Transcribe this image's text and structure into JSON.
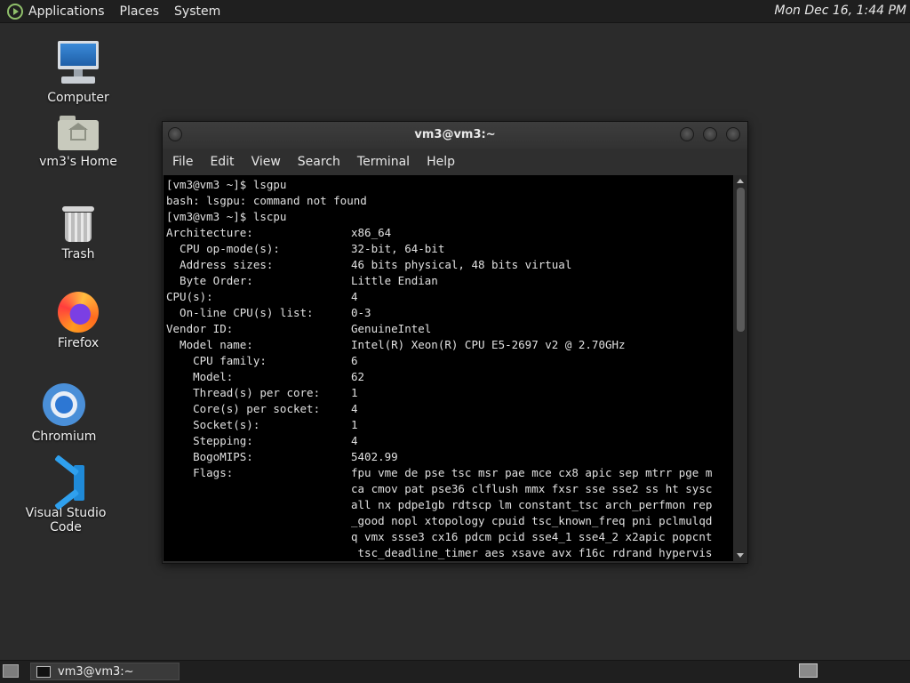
{
  "top_panel": {
    "menus": [
      "Applications",
      "Places",
      "System"
    ],
    "clock": "Mon Dec 16, 1:44 PM"
  },
  "desktop_icons": [
    {
      "label": "Computer",
      "icon": "computer-icon"
    },
    {
      "label": "vm3's Home",
      "icon": "home-folder-icon"
    },
    {
      "label": "Trash",
      "icon": "trash-icon"
    },
    {
      "label": "Firefox",
      "icon": "firefox-icon"
    },
    {
      "label": "Chromium",
      "icon": "chromium-icon"
    },
    {
      "label": "Visual Studio Code",
      "icon": "vscode-icon"
    }
  ],
  "terminal": {
    "title": "vm3@vm3:~",
    "menu": [
      "File",
      "Edit",
      "View",
      "Search",
      "Terminal",
      "Help"
    ],
    "lines": [
      {
        "text": "[vm3@vm3 ~]$ lsgpu"
      },
      {
        "text": "bash: lsgpu: command not found"
      },
      {
        "text": "[vm3@vm3 ~]$ lscpu"
      },
      {
        "key": "Architecture:",
        "value": "x86_64"
      },
      {
        "key": "  CPU op-mode(s):",
        "value": "32-bit, 64-bit"
      },
      {
        "key": "  Address sizes:",
        "value": "46 bits physical, 48 bits virtual"
      },
      {
        "key": "  Byte Order:",
        "value": "Little Endian"
      },
      {
        "key": "CPU(s):",
        "value": "4"
      },
      {
        "key": "  On-line CPU(s) list:",
        "value": "0-3"
      },
      {
        "key": "Vendor ID:",
        "value": "GenuineIntel"
      },
      {
        "key": "  Model name:",
        "value": "Intel(R) Xeon(R) CPU E5-2697 v2 @ 2.70GHz"
      },
      {
        "key": "    CPU family:",
        "value": "6"
      },
      {
        "key": "    Model:",
        "value": "62"
      },
      {
        "key": "    Thread(s) per core:",
        "value": "1"
      },
      {
        "key": "    Core(s) per socket:",
        "value": "4"
      },
      {
        "key": "    Socket(s):",
        "value": "1"
      },
      {
        "key": "    Stepping:",
        "value": "4"
      },
      {
        "key": "    BogoMIPS:",
        "value": "5402.99"
      },
      {
        "key": "    Flags:",
        "value": "fpu vme de pse tsc msr pae mce cx8 apic sep mtrr pge m"
      },
      {
        "key": "",
        "value": "ca cmov pat pse36 clflush mmx fxsr sse sse2 ss ht sysc"
      },
      {
        "key": "",
        "value": "all nx pdpe1gb rdtscp lm constant_tsc arch_perfmon rep"
      },
      {
        "key": "",
        "value": "_good nopl xtopology cpuid tsc_known_freq pni pclmulqd"
      },
      {
        "key": "",
        "value": "q vmx ssse3 cx16 pdcm pcid sse4_1 sse4_2 x2apic popcnt"
      },
      {
        "key": "",
        "value": " tsc_deadline_timer aes xsave avx f16c rdrand hypervis"
      }
    ]
  },
  "bottom_panel": {
    "taskbar_item": "vm3@vm3:~"
  }
}
